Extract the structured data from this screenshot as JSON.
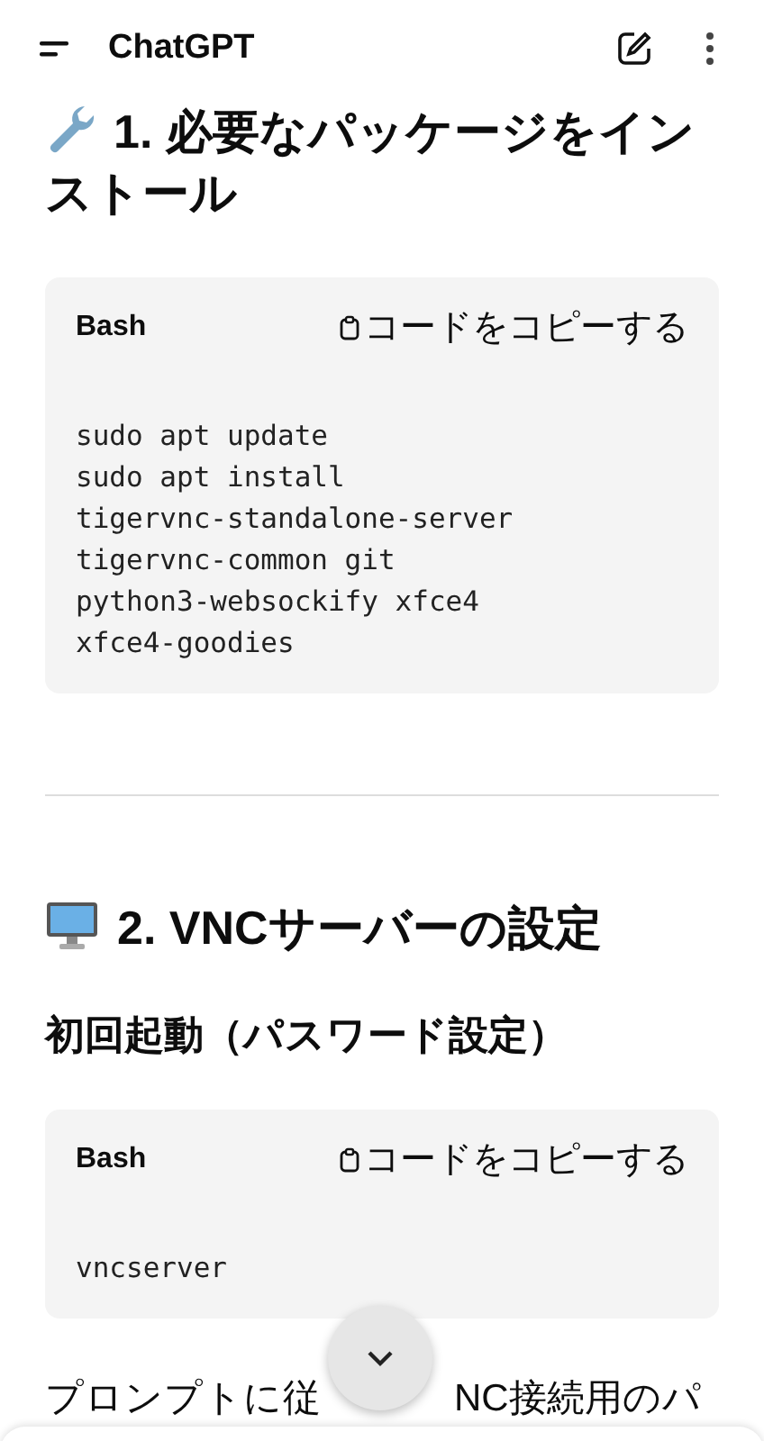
{
  "app_bar": {
    "title": "ChatGPT"
  },
  "content": [
    {
      "kind": "heading",
      "text": "1. 必要なパッケージをインストール"
    },
    {
      "kind": "code",
      "language": "Bash",
      "copy_label": "コードをコピーする",
      "lines": [
        "sudo apt update",
        "sudo apt install",
        "tigervnc-standalone-server",
        "tigervnc-common git",
        "python3-websockify xfce4",
        "xfce4-goodies"
      ]
    },
    {
      "kind": "rule"
    },
    {
      "kind": "heading",
      "text": "2. VNCサーバーの設定"
    },
    {
      "kind": "subheading",
      "text": "初回起動（パスワード設定）"
    },
    {
      "kind": "code",
      "language": "Bash",
      "copy_label": "コードをコピーする",
      "lines": [
        "vncserver"
      ]
    },
    {
      "kind": "paragraph",
      "text_parts": [
        "プロンプトに従",
        "NC接続用のパ"
      ]
    }
  ]
}
